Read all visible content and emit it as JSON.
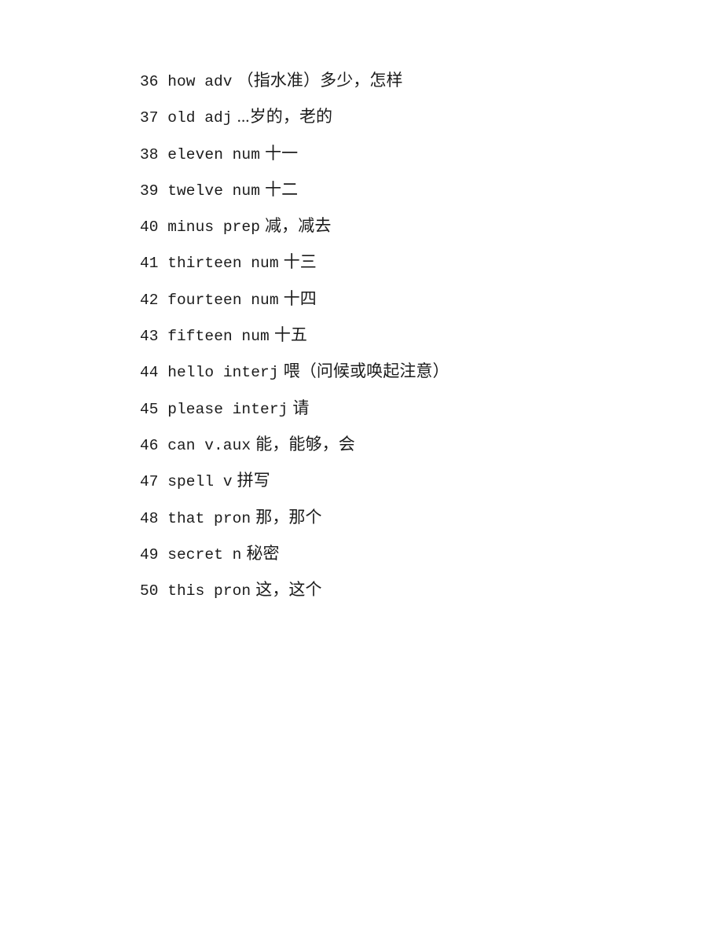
{
  "document": {
    "type": "vocabulary-list",
    "page_background": "#ffffff",
    "text_color": "#1b1b1b",
    "entries": [
      {
        "number": "36",
        "word": "how",
        "pos": "adv",
        "gloss": "（指水准）多少，怎样"
      },
      {
        "number": "37",
        "word": "old",
        "pos": "adj",
        "gloss": "...岁的，老的"
      },
      {
        "number": "38",
        "word": "eleven",
        "pos": "num",
        "gloss": "十一"
      },
      {
        "number": "39",
        "word": "twelve",
        "pos": "num",
        "gloss": "十二"
      },
      {
        "number": "40",
        "word": "minus",
        "pos": "prep",
        "gloss": "减，减去"
      },
      {
        "number": "41",
        "word": "thirteen",
        "pos": "num",
        "gloss": "十三"
      },
      {
        "number": "42",
        "word": "fourteen",
        "pos": "num",
        "gloss": "十四"
      },
      {
        "number": "43",
        "word": "fifteen",
        "pos": "num",
        "gloss": "十五"
      },
      {
        "number": "44",
        "word": "hello",
        "pos": "interj",
        "gloss": "喂（问候或唤起注意）"
      },
      {
        "number": "45",
        "word": "please",
        "pos": "interj",
        "gloss": "请"
      },
      {
        "number": "46",
        "word": "can",
        "pos": "v.aux",
        "gloss": "能，能够，会"
      },
      {
        "number": "47",
        "word": "spell",
        "pos": "v",
        "gloss": "拼写"
      },
      {
        "number": "48",
        "word": "that",
        "pos": "pron",
        "gloss": "那，那个"
      },
      {
        "number": "49",
        "word": "secret",
        "pos": "n",
        "gloss": "秘密"
      },
      {
        "number": "50",
        "word": "this",
        "pos": "pron",
        "gloss": "这，这个"
      }
    ]
  }
}
